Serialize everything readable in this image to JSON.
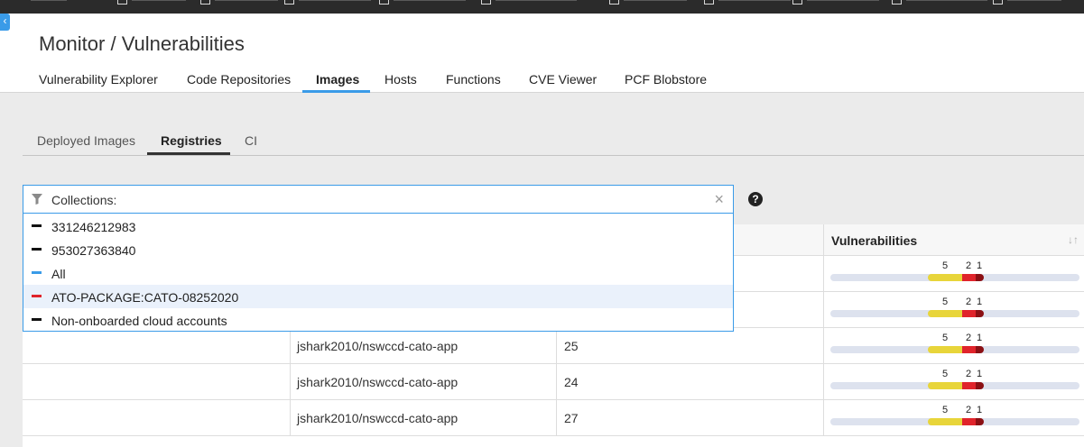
{
  "page": {
    "title": "Monitor / Vulnerabilities"
  },
  "main_tabs": [
    {
      "label": "Vulnerability Explorer",
      "active": false
    },
    {
      "label": "Code Repositories",
      "active": false
    },
    {
      "label": "Images",
      "active": true
    },
    {
      "label": "Hosts",
      "active": false
    },
    {
      "label": "Functions",
      "active": false
    },
    {
      "label": "CVE Viewer",
      "active": false
    },
    {
      "label": "PCF Blobstore",
      "active": false
    }
  ],
  "sub_tabs": [
    {
      "label": "Deployed Images",
      "active": false
    },
    {
      "label": "Registries",
      "active": true
    },
    {
      "label": "CI",
      "active": false
    }
  ],
  "filter": {
    "label": "Collections:",
    "clear_icon": "×",
    "help_icon": "?",
    "options": [
      {
        "label": "331246212983",
        "color": "#111111"
      },
      {
        "label": "953027363840",
        "color": "#111111"
      },
      {
        "label": "All",
        "color": "#3a9be8"
      },
      {
        "label": "ATO-PACKAGE:CATO-08252020",
        "color": "#e0242b"
      },
      {
        "label": "Non-onboarded cloud accounts",
        "color": "#111111"
      }
    ],
    "hovered_index": 3
  },
  "table": {
    "vulnerabilities_header": "Vulnerabilities",
    "sort_icon": "sort-arrows-icon",
    "rows": [
      {
        "repository": "",
        "tag": "",
        "vulns": {
          "medium": "5",
          "high": "2",
          "critical": "1"
        }
      },
      {
        "repository": "",
        "tag": "",
        "vulns": {
          "medium": "5",
          "high": "2",
          "critical": "1"
        }
      },
      {
        "repository": "jshark2010/nswccd-cato-app",
        "tag": "25",
        "vulns": {
          "medium": "5",
          "high": "2",
          "critical": "1"
        }
      },
      {
        "repository": "jshark2010/nswccd-cato-app",
        "tag": "24",
        "vulns": {
          "medium": "5",
          "high": "2",
          "critical": "1"
        }
      },
      {
        "repository": "jshark2010/nswccd-cato-app",
        "tag": "27",
        "vulns": {
          "medium": "5",
          "high": "2",
          "critical": "1"
        }
      }
    ]
  },
  "colors": {
    "accent": "#3a9be8",
    "medium": "#e8d53a",
    "high": "#e0242b",
    "critical": "#8b1014"
  }
}
